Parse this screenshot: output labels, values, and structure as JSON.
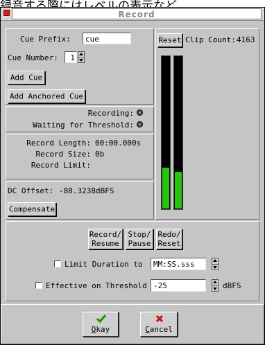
{
  "background_text": "録音する際にはレベルの表示など",
  "window": {
    "title": "Record"
  },
  "cue": {
    "prefix_label": "Cue Prefix:",
    "prefix_value": "cue",
    "number_label": "Cue Number:",
    "number_value": "1",
    "add_cue": "Add Cue",
    "add_anchored_cue": "Add Anchored Cue"
  },
  "status": {
    "recording_label": "Recording:",
    "waiting_label": "Waiting for Threshold:"
  },
  "info": {
    "length_label": "Record Length:",
    "length_value": "00:00.000s",
    "size_label": "Record Size:",
    "size_value": "0b",
    "limit_label": "Record Limit:",
    "limit_value": ""
  },
  "dc": {
    "label": "DC Offset:",
    "value": "-88.3238dBFS",
    "compensate": "Compensate"
  },
  "meter": {
    "reset": "Reset",
    "clip_label": "Clip Count:",
    "clip_count": "4163",
    "left_level": 0.27,
    "right_level": 0.24,
    "level_color": "#28c40e"
  },
  "transport": {
    "record_resume_1": "Record/",
    "record_resume_2": "Resume",
    "stop_pause_1": "Stop/",
    "stop_pause_2": "Pause",
    "redo_reset_1": "Redo/",
    "redo_reset_2": "Reset"
  },
  "options": {
    "limit_duration_label": "Limit Duration to",
    "limit_duration_value": "MM:SS.sss",
    "threshold_label": "Effective on Threshold",
    "threshold_value": "-25",
    "threshold_unit": "dBFS"
  },
  "footer": {
    "okay_u": "O",
    "okay_rest": "kay",
    "cancel_u": "C",
    "cancel_rest": "ancel",
    "okay_icon": "checkmark-icon",
    "cancel_icon": "x-icon"
  }
}
